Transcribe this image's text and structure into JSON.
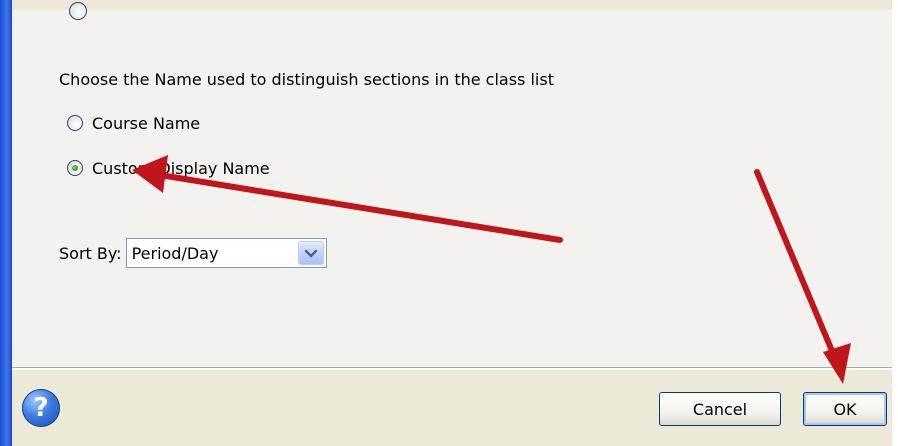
{
  "dialog": {
    "instruction": "Choose the Name used to distinguish sections in the class list",
    "options": [
      {
        "label": "Course Name",
        "selected": false
      },
      {
        "label": "Custom Display Name",
        "selected": true
      }
    ],
    "sort": {
      "label": "Sort By:",
      "value": "Period/Day"
    }
  },
  "footer": {
    "help_icon": "question-mark-icon",
    "help_glyph": "?",
    "cancel_label": "Cancel",
    "ok_label": "OK"
  },
  "annotations": {
    "arrow_color": "#c0161b",
    "arrows": [
      "arrow-to-custom-display-name",
      "arrow-to-ok-button"
    ]
  },
  "colors": {
    "xp_blue": "#2f66e6",
    "dialog_bg": "#ece9d8",
    "content_bg": "#f3f2ef"
  }
}
